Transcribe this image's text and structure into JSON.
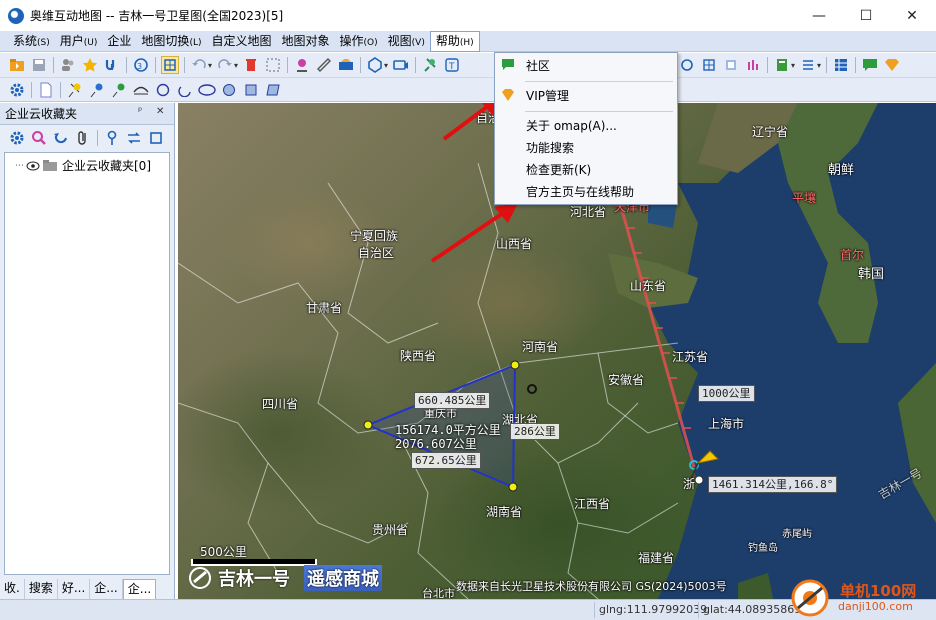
{
  "window": {
    "title": "奥维互动地图 -- 吉林一号卫星图(全国2023)[5]",
    "minimize_glyph": "—",
    "maximize_glyph": "☐",
    "close_glyph": "✕"
  },
  "menu": [
    {
      "label": "系统",
      "accel": "(S)"
    },
    {
      "label": "用户",
      "accel": "(U)"
    },
    {
      "label": "企业",
      "accel": ""
    },
    {
      "label": "地图切换",
      "accel": "(L)"
    },
    {
      "label": "自定义地图",
      "accel": ""
    },
    {
      "label": "地图对象",
      "accel": ""
    },
    {
      "label": "操作",
      "accel": "(O)"
    },
    {
      "label": "视图",
      "accel": "(V)"
    },
    {
      "label": "帮助",
      "accel": "(H)"
    }
  ],
  "help_menu": {
    "items": [
      "社区",
      "VIP管理",
      "关于 omap(A)...",
      "功能搜索",
      "检查更新(K)",
      "官方主页与在线帮助"
    ]
  },
  "left_panel": {
    "title": "企业云收藏夹",
    "pin_glyph": "ᵖ",
    "close_glyph": "✕",
    "tree_root": "企业云收藏夹[0]",
    "tabs": [
      "收.",
      "搜索",
      "好...",
      "企...",
      "企..."
    ]
  },
  "map": {
    "labels": [
      {
        "text": "辽宁省",
        "red": false
      },
      {
        "text": "朝鲜",
        "red": false
      },
      {
        "text": "平壤",
        "red": true
      },
      {
        "text": "首尔",
        "red": true
      },
      {
        "text": "韩国",
        "red": false
      },
      {
        "text": "宁夏回族",
        "red": false
      },
      {
        "text": "自治区",
        "red": false
      },
      {
        "text": "山西省",
        "red": false
      },
      {
        "text": "河北省",
        "red": false
      },
      {
        "text": "天津市",
        "red": true
      },
      {
        "text": "山东省",
        "red": false
      },
      {
        "text": "甘肃省",
        "red": false
      },
      {
        "text": "陕西省",
        "red": false
      },
      {
        "text": "河南省",
        "red": false
      },
      {
        "text": "江苏省",
        "red": false
      },
      {
        "text": "安徽省",
        "red": false
      },
      {
        "text": "四川省",
        "red": false
      },
      {
        "text": "重庆市",
        "red": false
      },
      {
        "text": "上海市",
        "red": false
      },
      {
        "text": "湖北省",
        "red": false
      },
      {
        "text": "浙",
        "red": false
      },
      {
        "text": "湖南省",
        "red": false
      },
      {
        "text": "江西省",
        "red": false
      },
      {
        "text": "贵州省",
        "red": false
      },
      {
        "text": "福建省",
        "red": false
      },
      {
        "text": "赤尾屿",
        "red": false
      },
      {
        "text": "钓鱼岛",
        "red": false
      },
      {
        "text": "台北市",
        "red": false
      },
      {
        "text": "自治",
        "red": false
      },
      {
        "text": "吉林一号",
        "red": false
      }
    ],
    "measures": {
      "edge_top": "660.485公里",
      "area": "156174.0平方公里",
      "perimeter": "2076.607公里",
      "edge_right": "286公里",
      "edge_bottom": "672.65公里",
      "ruler_mark": "1000公里",
      "ruler_total": "1461.314公里,166.8°"
    },
    "scale": "500公里",
    "brand_logo": "吉林一号",
    "brand_sub": "遥感商城",
    "copyright": "数据来自长光卫星技术股份有限公司 GS(2024)5003号"
  },
  "status": {
    "lng": "glng:111.97992039",
    "lat": "glat:44.08935869"
  },
  "watermark": {
    "site": "单机100网",
    "url": "danji100.com"
  },
  "colors": {
    "menubar": "#dae3f3",
    "toolbar": "#e5ecf7",
    "polygon": "#2233cc",
    "ruler": "#e05050",
    "arrow": "#e01010"
  }
}
